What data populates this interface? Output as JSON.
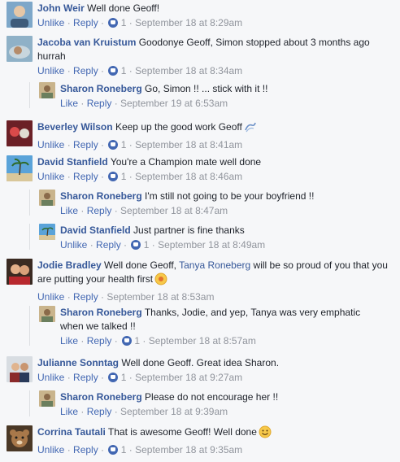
{
  "actions": {
    "unlike": "Unlike",
    "like": "Like",
    "reply": "Reply",
    "sep": " · "
  },
  "comments": [
    {
      "author": "John Weir",
      "text": "Well done Geoff!",
      "like_label": "Unlike",
      "likes": "1",
      "time": "September 18 at 8:29am"
    },
    {
      "author": "Jacoba van Kruistum",
      "text": "Goodonye Geoff, Simon stopped about 3 months ago hurrah",
      "like_label": "Unlike",
      "likes": "1",
      "time": "September 18 at 8:34am"
    },
    {
      "author": "Sharon Roneberg",
      "text": "Go, Simon !! ... stick with it !!",
      "like_label": "Like",
      "likes": "",
      "time": "September 19 at 6:53am"
    },
    {
      "author": "Beverley Wilson",
      "text": "Keep up the good work Geoff",
      "emoji": "wave-emoji",
      "like_label": "Unlike",
      "likes": "1",
      "time": "September 18 at 8:41am"
    },
    {
      "author": "David Stanfield",
      "text": "You're a Champion mate well done",
      "like_label": "Unlike",
      "likes": "1",
      "time": "September 18 at 8:46am"
    },
    {
      "author": "Sharon Roneberg",
      "text": "I'm still not going to be your boyfriend !!",
      "like_label": "Like",
      "likes": "",
      "time": "September 18 at 8:47am"
    },
    {
      "author": "David Stanfield",
      "text": "Just partner is fine thanks",
      "like_label": "Unlike",
      "likes": "1",
      "time": "September 18 at 8:49am"
    },
    {
      "author": "Jodie Bradley",
      "text_before": "Well done Geoff,",
      "mention": "Tanya Roneberg",
      "text_after": "will be so proud of you that you are putting your health first",
      "emoji": "cheer-emoji",
      "like_label": "Unlike",
      "likes": "",
      "time": "September 18 at 8:53am"
    },
    {
      "author": "Sharon Roneberg",
      "text": "Thanks, Jodie, and yep, Tanya was very emphatic when we talked !!",
      "like_label": "Like",
      "likes": "1",
      "time": "September 18 at 8:57am"
    },
    {
      "author": "Julianne Sonntag",
      "text": "Well done Geoff. Great idea Sharon.",
      "like_label": "Unlike",
      "likes": "1",
      "time": "September 18 at 9:27am"
    },
    {
      "author": "Sharon Roneberg",
      "text": "Please do not encourage her !!",
      "like_label": "Like",
      "likes": "",
      "time": "September 18 at 9:39am"
    },
    {
      "author": "Corrina Tautali",
      "text": "That is awesome Geoff! Well done",
      "emoji": "smile-emoji",
      "like_label": "Unlike",
      "likes": "1",
      "time": "September 18 at 9:35am"
    }
  ],
  "colors": {
    "link": "#365899",
    "action": "#4267b2",
    "meta": "#90949c",
    "background": "#f6f7f9"
  }
}
